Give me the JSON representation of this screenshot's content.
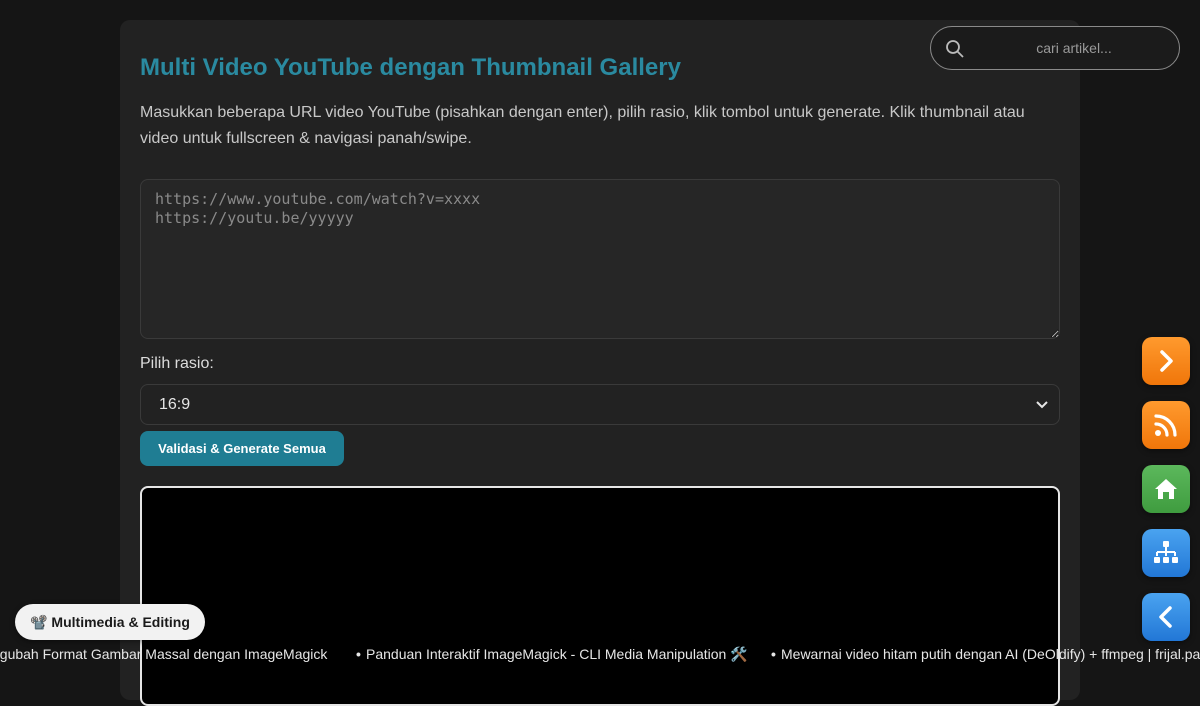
{
  "page": {
    "title": "Multi Video YouTube dengan Thumbnail Gallery",
    "description": "Masukkan beberapa URL video YouTube (pisahkan dengan enter), pilih rasio, klik tombol untuk generate. Klik thumbnail atau video untuk fullscreen & navigasi panah/swipe."
  },
  "form": {
    "urls_placeholder": "https://www.youtube.com/watch?v=xxxx\nhttps://youtu.be/yyyyy",
    "ratio_label": "Pilih rasio:",
    "ratio_value": "16:9",
    "generate_label": "Validasi & Generate Semua"
  },
  "search": {
    "placeholder": "cari artikel..."
  },
  "sidebar_buttons": [
    {
      "icon": "chevron-right-icon",
      "color": "#f0760a"
    },
    {
      "icon": "rss-icon",
      "color": "#f0760a"
    },
    {
      "icon": "home-icon",
      "color": "#3f9c3f"
    },
    {
      "icon": "sitemap-icon",
      "color": "#2277d6"
    },
    {
      "icon": "chevron-left-icon",
      "color": "#2277d6"
    }
  ],
  "category_pill": {
    "label": "📽️ Multimedia & Editing"
  },
  "ticker": {
    "items": [
      "ngubah Format Gambar Massal dengan ImageMagick",
      "Panduan Interaktif ImageMagick - CLI Media Manipulation 🛠️",
      "Mewarnai video hitam putih dengan AI (DeOldify) + ffmpeg | frijal.page"
    ]
  },
  "colors": {
    "accent": "#2a8aa0",
    "button": "#1f7d93",
    "background": "#151515",
    "card": "#222222"
  }
}
